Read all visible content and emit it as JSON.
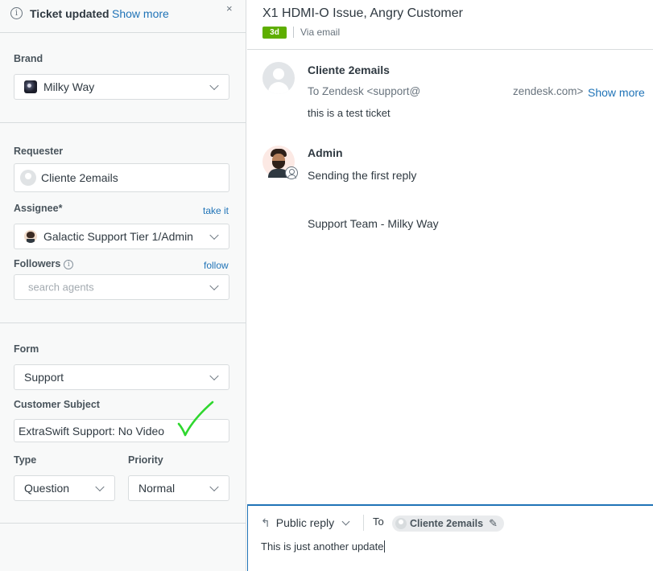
{
  "notice": {
    "title": "Ticket updated",
    "link": "Show more",
    "close": "×",
    "info_icon": "info-icon"
  },
  "brand": {
    "label": "Brand",
    "value": "Milky Way"
  },
  "requester": {
    "label": "Requester",
    "value": "Cliente 2emails"
  },
  "assignee": {
    "label": "Assignee*",
    "action": "take it",
    "value": "Galactic Support Tier 1/Admin"
  },
  "followers": {
    "label": "Followers",
    "action": "follow",
    "placeholder": "search agents"
  },
  "form": {
    "label": "Form",
    "value": "Support"
  },
  "customer_subject": {
    "label": "Customer Subject",
    "value": "ExtraSwift Support: No Video"
  },
  "type": {
    "label": "Type",
    "value": "Question"
  },
  "priority": {
    "label": "Priority",
    "value": "Normal"
  },
  "ticket": {
    "title": "X1 HDMI-O Issue, Angry Customer",
    "age_badge": "3d",
    "channel": "Via email",
    "accent_badge_color": "#5eae00"
  },
  "messages": [
    {
      "author": "Cliente 2emails",
      "to_prefix": "To Zendesk <support@",
      "to_suffix": "zendesk.com>",
      "show_more": "Show more",
      "body": "this is a test ticket"
    },
    {
      "author": "Admin",
      "body": "Sending the first reply",
      "signature": "Support Team - Milky Way"
    }
  ],
  "composer": {
    "reply_type": "Public reply",
    "to_label": "To",
    "recipient": "Cliente 2emails",
    "text": "This is just another update",
    "accent_color": "#1f73b7"
  }
}
